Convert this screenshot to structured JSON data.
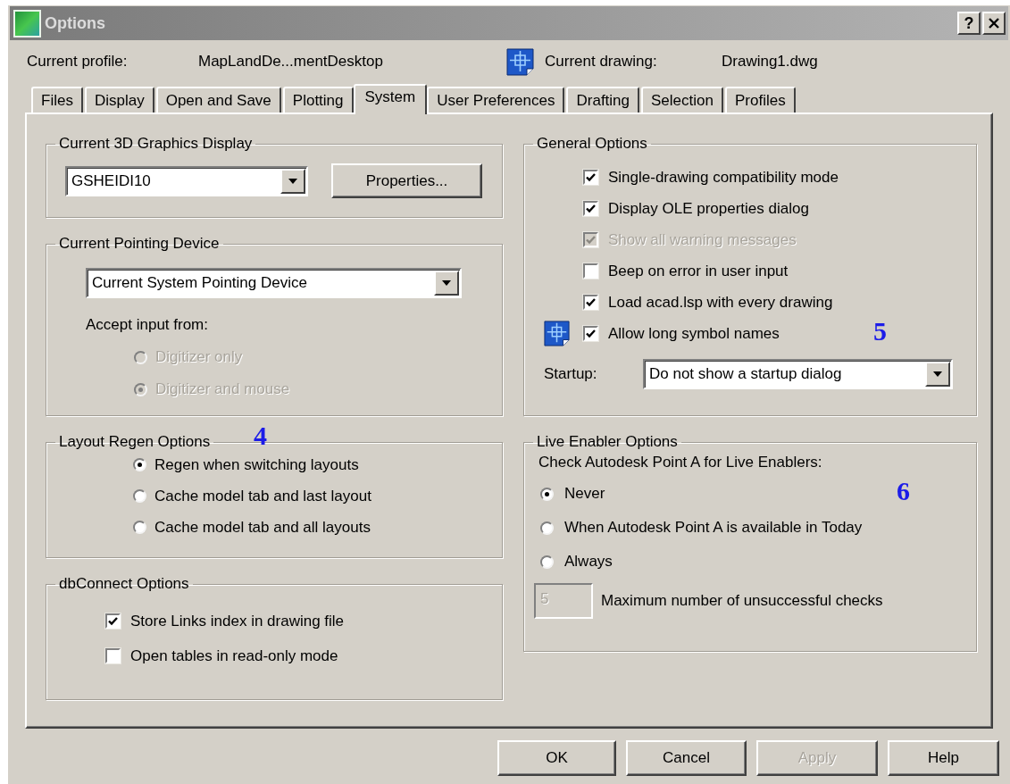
{
  "window": {
    "title": "Options",
    "help_button": "?"
  },
  "header": {
    "profile_label": "Current profile:",
    "profile_value": "MapLandDe...mentDesktop",
    "drawing_label": "Current drawing:",
    "drawing_value": "Drawing1.dwg"
  },
  "tabs": [
    {
      "label": "Files",
      "selected": false
    },
    {
      "label": "Display",
      "selected": false
    },
    {
      "label": "Open and Save",
      "selected": false
    },
    {
      "label": "Plotting",
      "selected": false
    },
    {
      "label": "System",
      "selected": true
    },
    {
      "label": "User Preferences",
      "selected": false
    },
    {
      "label": "Drafting",
      "selected": false
    },
    {
      "label": "Selection",
      "selected": false
    },
    {
      "label": "Profiles",
      "selected": false
    }
  ],
  "graphics_display": {
    "title": "Current 3D Graphics Display",
    "dropdown": "GSHEIDI10",
    "button": "Properties..."
  },
  "pointing_device": {
    "title": "Current Pointing Device",
    "dropdown": "Current System Pointing Device",
    "accept_label": "Accept input from:",
    "options": [
      {
        "label": "Digitizer only",
        "selected": false,
        "disabled": true
      },
      {
        "label": "Digitizer and mouse",
        "selected": true,
        "disabled": true
      }
    ]
  },
  "layout_regen": {
    "title": "Layout Regen Options",
    "callout": "4",
    "options": [
      {
        "label": "Regen when switching layouts",
        "selected": true
      },
      {
        "label": "Cache model tab and last layout",
        "selected": false
      },
      {
        "label": "Cache model tab and all layouts",
        "selected": false
      }
    ]
  },
  "db_connect": {
    "title": "dbConnect Options",
    "options": [
      {
        "label": "Store Links index in drawing file",
        "checked": true
      },
      {
        "label": "Open tables in read-only mode",
        "checked": false
      }
    ]
  },
  "general_options": {
    "title": "General Options",
    "callout": "5",
    "options": [
      {
        "label": "Single-drawing compatibility mode",
        "checked": true,
        "disabled": false,
        "icon": false
      },
      {
        "label": "Display OLE properties dialog",
        "checked": true,
        "disabled": false,
        "icon": false
      },
      {
        "label": "Show all warning messages",
        "checked": true,
        "disabled": true,
        "icon": false
      },
      {
        "label": "Beep on error in user input",
        "checked": false,
        "disabled": false,
        "icon": false
      },
      {
        "label": "Load acad.lsp with every drawing",
        "checked": true,
        "disabled": false,
        "icon": false
      },
      {
        "label": "Allow long symbol names",
        "checked": true,
        "disabled": false,
        "icon": true
      }
    ],
    "startup_label": "Startup:",
    "startup_value": "Do not show a startup dialog"
  },
  "live_enabler": {
    "title": "Live Enabler Options",
    "callout": "6",
    "prompt": "Check Autodesk Point A for Live Enablers:",
    "options": [
      {
        "label": "Never",
        "selected": true
      },
      {
        "label": "When Autodesk Point A is available in Today",
        "selected": false
      },
      {
        "label": "Always",
        "selected": false
      }
    ],
    "max_checks": {
      "value": "5",
      "disabled": true,
      "label": "Maximum number of unsuccessful checks"
    }
  },
  "buttons": [
    {
      "label": "OK",
      "disabled": false
    },
    {
      "label": "Cancel",
      "disabled": false
    },
    {
      "label": "Apply",
      "disabled": true
    },
    {
      "label": "Help",
      "disabled": false
    }
  ]
}
